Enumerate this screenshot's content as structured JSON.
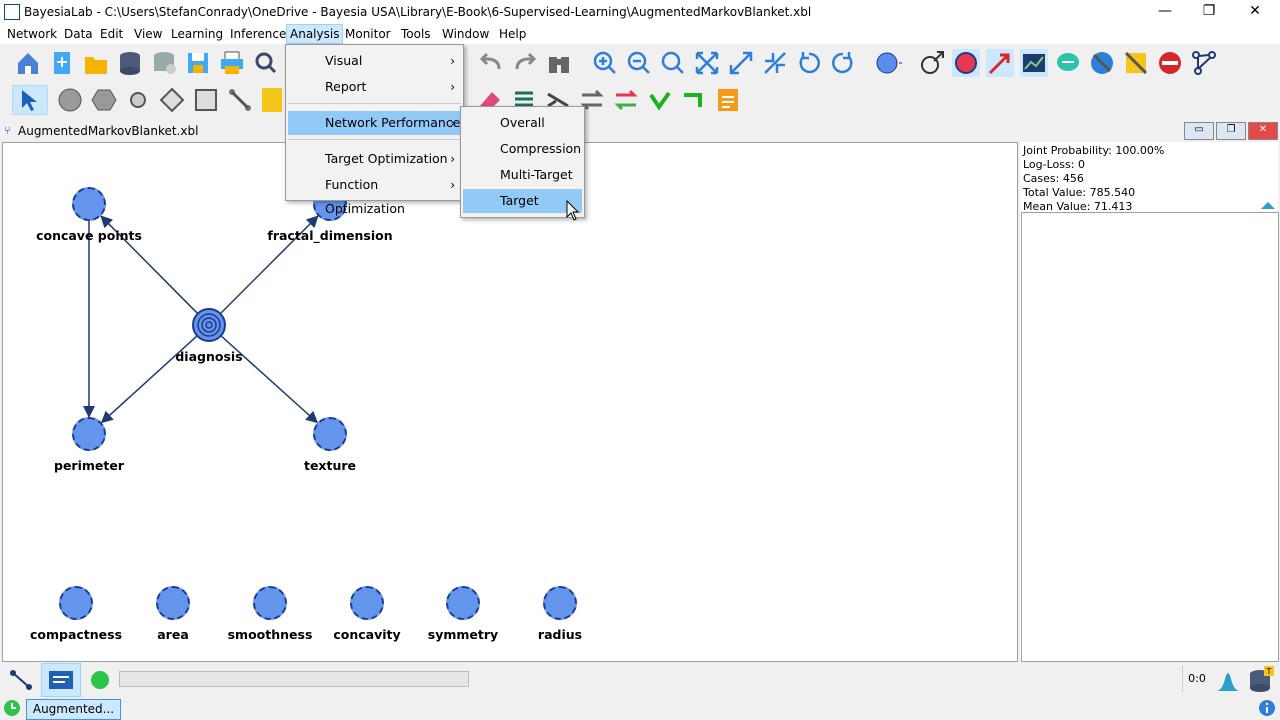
{
  "window": {
    "title": "BayesiaLab - C:\\Users\\StefanConradу\\OneDrive - Bayesia USA\\Library\\E-Book\\6-Supervised-Learning\\AugmentedMarkovBlanket.xbl",
    "minimize": "—",
    "restore": "❐",
    "close": "✕"
  },
  "menubar": [
    "Network",
    "Data",
    "Edit",
    "View",
    "Learning",
    "Inference",
    "Analysis",
    "Monitor",
    "Tools",
    "Window",
    "Help"
  ],
  "analysis_menu": {
    "items": [
      {
        "label": "Visual",
        "has_sub": true
      },
      {
        "label": "Report",
        "has_sub": true
      },
      {
        "label": "Network Performance",
        "has_sub": true
      },
      {
        "label": "Target Optimization",
        "has_sub": true
      },
      {
        "label": "Function Optimization",
        "has_sub": true
      }
    ],
    "highlighted": "Network Performance"
  },
  "submenu": {
    "items": [
      "Overall",
      "Compression",
      "Multi-Target",
      "Target"
    ],
    "highlighted": "Target"
  },
  "document": {
    "title": "AugmentedMarkovBlanket.xbl"
  },
  "nodes": [
    {
      "id": "concave_points",
      "label": "concave points"
    },
    {
      "id": "fractal_dimension",
      "label": "fractal_dimension"
    },
    {
      "id": "diagnosis",
      "label": "diagnosis",
      "target": true
    },
    {
      "id": "perimeter",
      "label": "perimeter"
    },
    {
      "id": "texture",
      "label": "texture"
    },
    {
      "id": "compactness",
      "label": "compactness"
    },
    {
      "id": "area",
      "label": "area"
    },
    {
      "id": "smoothness",
      "label": "smoothness"
    },
    {
      "id": "concavity",
      "label": "concavity"
    },
    {
      "id": "symmetry",
      "label": "symmetry"
    },
    {
      "id": "radius",
      "label": "radius"
    }
  ],
  "edges": [
    {
      "from": "diagnosis",
      "to": "concave_points"
    },
    {
      "from": "diagnosis",
      "to": "fractal_dimension"
    },
    {
      "from": "diagnosis",
      "to": "perimeter"
    },
    {
      "from": "diagnosis",
      "to": "texture"
    },
    {
      "from": "concave_points",
      "to": "perimeter"
    }
  ],
  "stats": {
    "joint_probability": "Joint Probability: 100.00%",
    "log_loss": "Log-Loss: 0",
    "cases": "Cases: 456",
    "total_value": "Total Value: 785.540",
    "mean_value": "Mean Value: 71.413"
  },
  "status": {
    "tab_label": "Augmented...",
    "counter": "0:0"
  },
  "colors": {
    "node_fill": "#6495ed",
    "node_border": "#1e3a8a",
    "menu_highlight": "#91c9f7",
    "edge": "#1e3a6e"
  }
}
